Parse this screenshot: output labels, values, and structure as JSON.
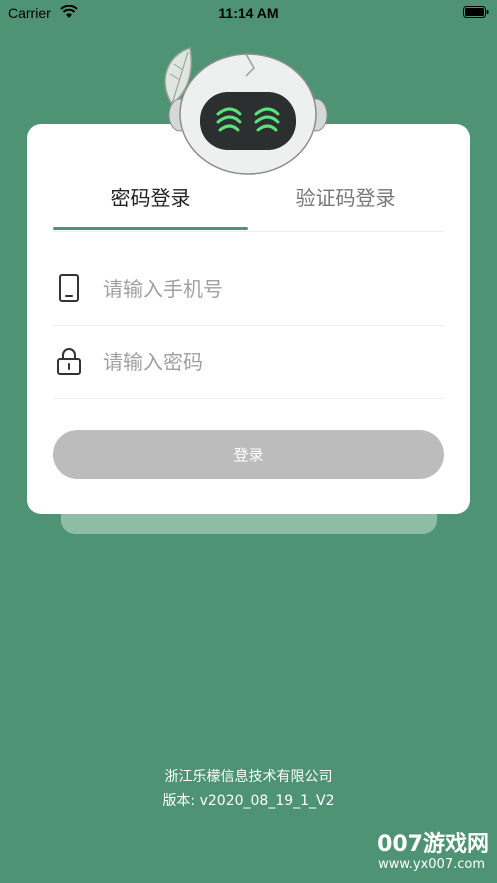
{
  "status_bar": {
    "carrier": "Carrier",
    "time": "11:14 AM"
  },
  "tabs": {
    "password_login": "密码登录",
    "code_login": "验证码登录"
  },
  "phone_field": {
    "placeholder": "请输入手机号"
  },
  "password_field": {
    "placeholder": "请输入密码"
  },
  "login_button": {
    "label": "登录"
  },
  "footer": {
    "company": "浙江乐檬信息技术有限公司",
    "version": "版本: v2020_08_19_1_V2"
  },
  "watermark": {
    "brand": "007游戏网",
    "url": "www.yx007.com"
  },
  "colors": {
    "brand_green": "#4e9373",
    "button_disabled": "#bcbcbc",
    "card_shadow": "#8ebda6"
  }
}
